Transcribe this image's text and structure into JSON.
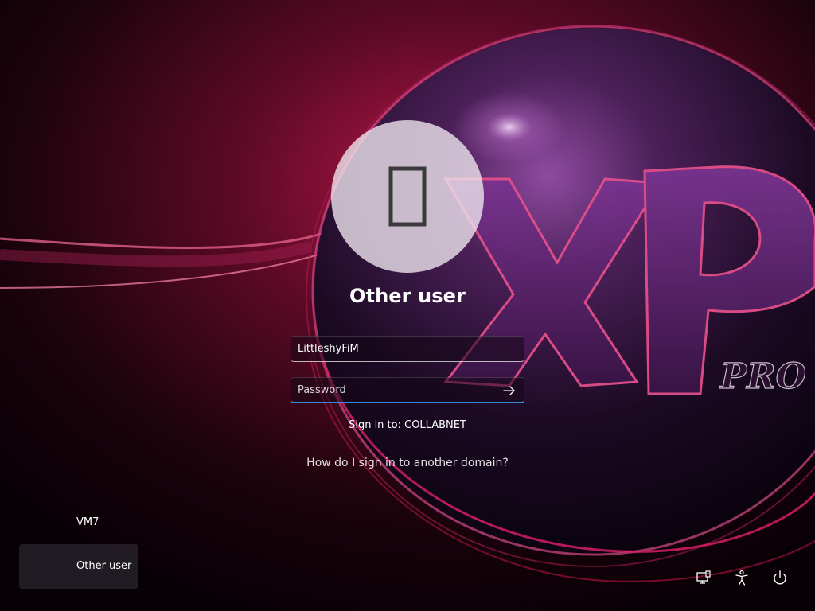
{
  "login": {
    "user_display_name": "Other user",
    "username_value": "LittleshyFiM",
    "password_placeholder": "Password",
    "sign_in_to": "Sign in to: COLLABNET",
    "domain_help_link": "How do I sign in to another domain?"
  },
  "wallpaper": {
    "logo_text": "XP",
    "logo_subtext": "PRO"
  },
  "user_list": [
    {
      "label": "VM7"
    },
    {
      "label": "Other user",
      "selected": true
    }
  ],
  "tray": {
    "icons": [
      "network-icon",
      "accessibility-icon",
      "power-icon"
    ]
  },
  "colors": {
    "accent": "#3b86d8",
    "background": "#0a0106",
    "glow": "#c41a4e",
    "sphere": "#6a2d6e"
  }
}
